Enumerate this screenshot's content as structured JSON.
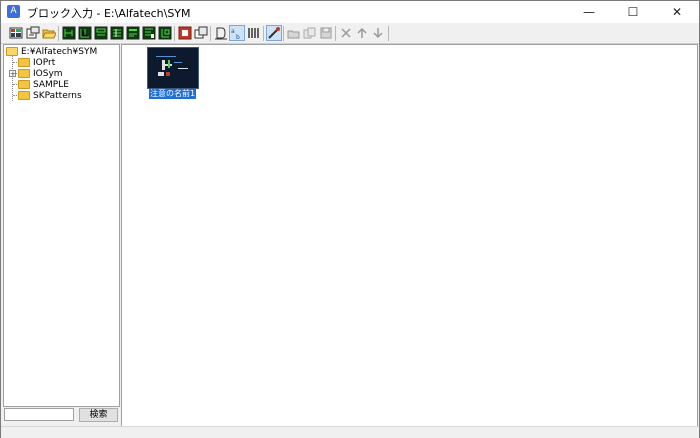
{
  "window": {
    "title": "ブロック入力 - E:\\Alfatech\\SYM",
    "app_icon": "A",
    "minimize_glyph": "—",
    "maximize_glyph": "☐",
    "close_glyph": "✕"
  },
  "toolbar": {
    "icons": [
      "grid-view-icon",
      "properties-icon",
      "open-folder-icon",
      "block-green-1-icon",
      "block-green-2-icon",
      "block-green-3-icon",
      "block-green-4-icon",
      "block-green-5-icon",
      "block-green-6-icon",
      "block-red-icon",
      "copy-window-icon",
      "text-edit-icon",
      "sort-icon",
      "columns-icon",
      "magic-wand-icon",
      "new-folder-icon",
      "copy-icon",
      "save-icon",
      "delete-icon",
      "arrow-up-icon",
      "arrow-down-icon"
    ]
  },
  "tree": {
    "root": "E:¥Alfatech¥SYM",
    "items": [
      {
        "label": "IOPrt",
        "expandable": false
      },
      {
        "label": "IOSym",
        "expandable": true
      },
      {
        "label": "SAMPLE",
        "expandable": false
      },
      {
        "label": "SKPatterns",
        "expandable": false
      }
    ]
  },
  "search": {
    "value": "",
    "placeholder": "",
    "button_label": "検索"
  },
  "files": [
    {
      "label": "注意の名前1",
      "selected": true
    }
  ],
  "colors": {
    "selection": "#1e6fd6",
    "folder": "#f5c542",
    "thumbnail_bg": "#0d1a2e"
  }
}
